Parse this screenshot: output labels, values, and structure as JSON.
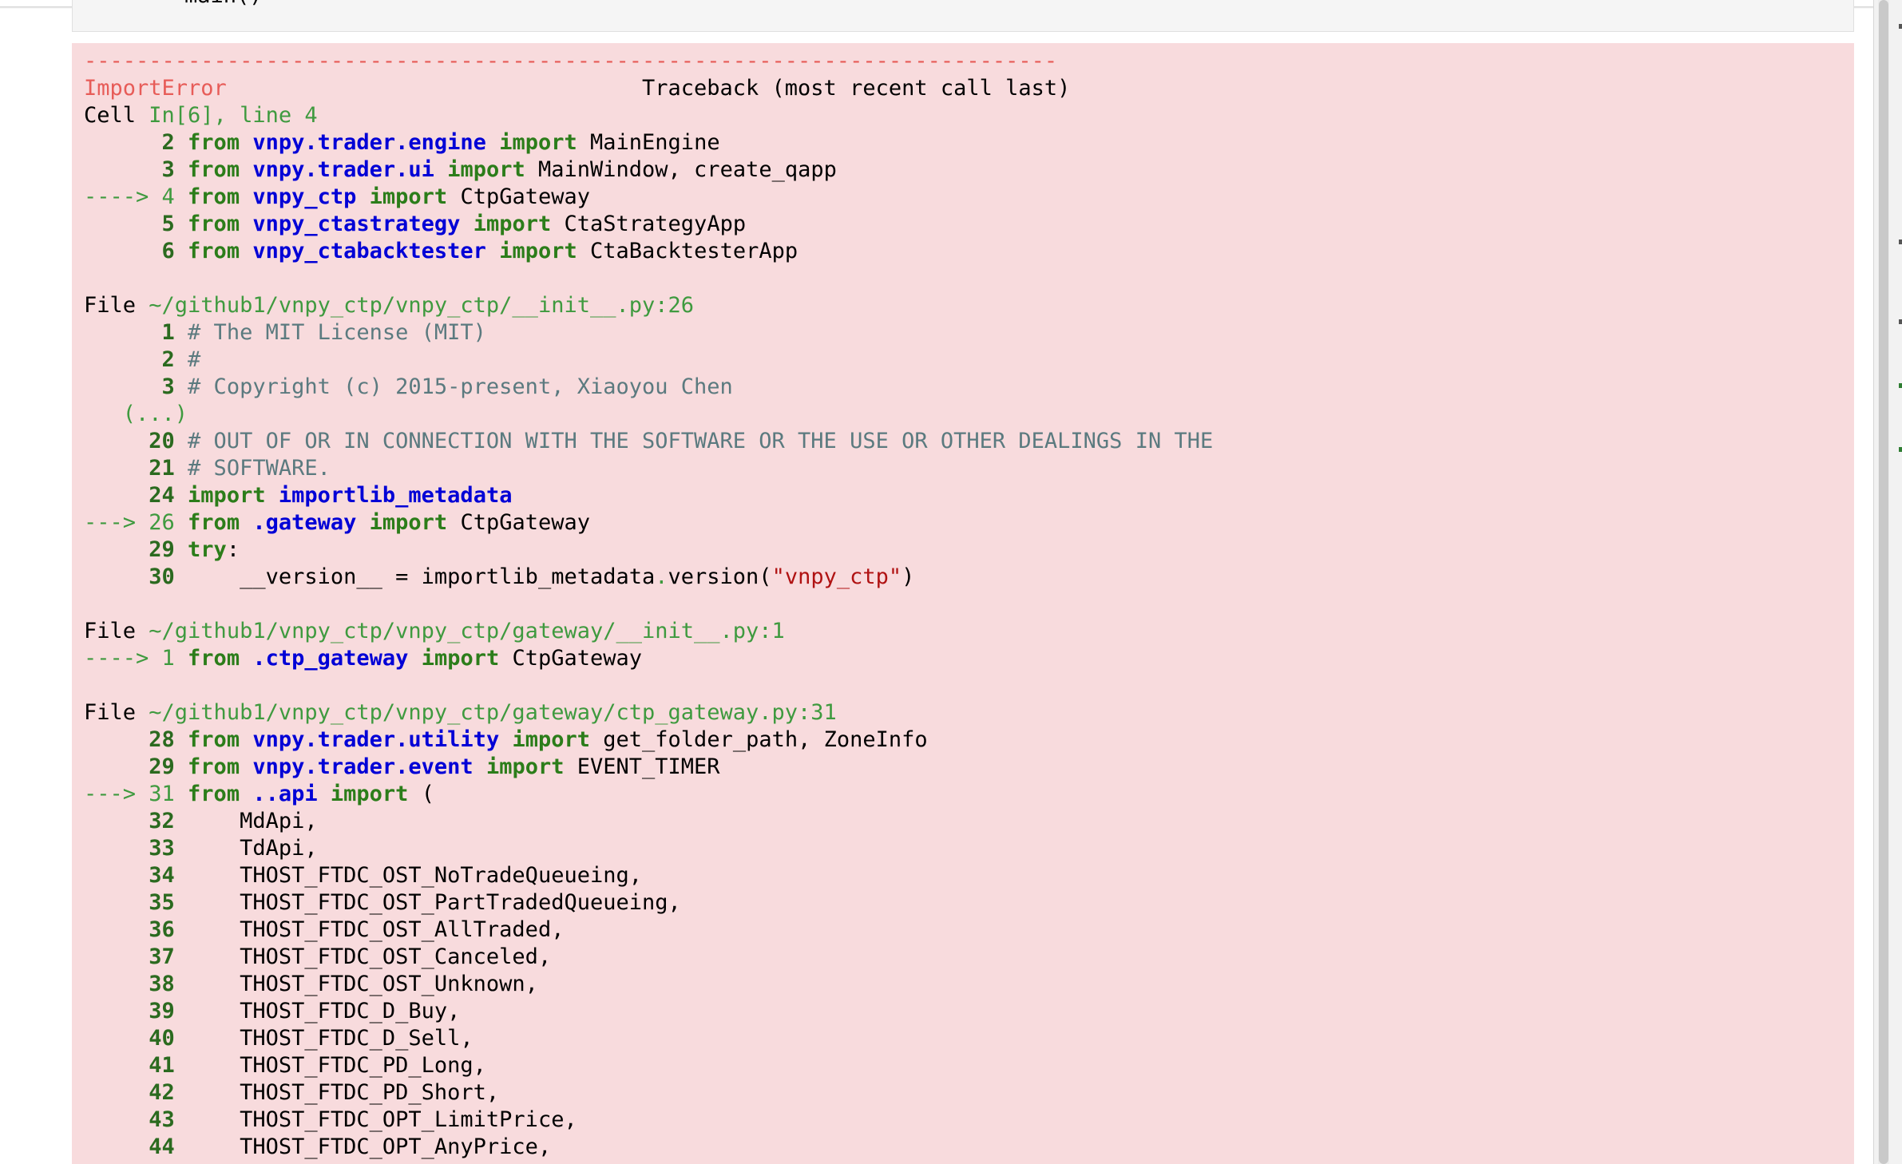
{
  "top_cell": {
    "code": "    main()"
  },
  "traceback": {
    "dash_line": "---------------------------------------------------------------------------",
    "header": {
      "name": "ImportError",
      "gap": "                                ",
      "title": "Traceback (most recent call last)"
    },
    "lines": [
      [
        [
          "",
          "Cell "
        ],
        [
          "green",
          "In[6], line 4"
        ]
      ],
      [
        [
          "lnum",
          "      2 "
        ],
        [
          "kw",
          "from"
        ],
        [
          "",
          " "
        ],
        [
          "mod",
          "vnpy.trader.engine"
        ],
        [
          "",
          " "
        ],
        [
          "kw",
          "import"
        ],
        [
          "",
          " MainEngine"
        ]
      ],
      [
        [
          "lnum",
          "      3 "
        ],
        [
          "kw",
          "from"
        ],
        [
          "",
          " "
        ],
        [
          "mod",
          "vnpy.trader.ui"
        ],
        [
          "",
          " "
        ],
        [
          "kw",
          "import"
        ],
        [
          "",
          " MainWindow, create_qapp"
        ]
      ],
      [
        [
          "arrow",
          "----> 4 "
        ],
        [
          "kw",
          "from"
        ],
        [
          "",
          " "
        ],
        [
          "mod",
          "vnpy_ctp"
        ],
        [
          "",
          " "
        ],
        [
          "kw",
          "import"
        ],
        [
          "",
          " CtpGateway"
        ]
      ],
      [
        [
          "lnum",
          "      5 "
        ],
        [
          "kw",
          "from"
        ],
        [
          "",
          " "
        ],
        [
          "mod",
          "vnpy_ctastrategy"
        ],
        [
          "",
          " "
        ],
        [
          "kw",
          "import"
        ],
        [
          "",
          " CtaStrategyApp"
        ]
      ],
      [
        [
          "lnum",
          "      6 "
        ],
        [
          "kw",
          "from"
        ],
        [
          "",
          " "
        ],
        [
          "mod",
          "vnpy_ctabacktester"
        ],
        [
          "",
          " "
        ],
        [
          "kw",
          "import"
        ],
        [
          "",
          " CtaBacktesterApp"
        ]
      ],
      [
        [
          "",
          " "
        ]
      ],
      [
        [
          "",
          "File "
        ],
        [
          "green",
          "~/github1/vnpy_ctp/vnpy_ctp/__init__.py:26"
        ]
      ],
      [
        [
          "lnum",
          "      1 "
        ],
        [
          "cmt",
          "# The MIT License (MIT)"
        ]
      ],
      [
        [
          "lnum",
          "      2 "
        ],
        [
          "cmt",
          "#"
        ]
      ],
      [
        [
          "lnum",
          "      3 "
        ],
        [
          "cmt",
          "# Copyright (c) 2015-present, Xiaoyou Chen"
        ]
      ],
      [
        [
          "green",
          "   (...)"
        ]
      ],
      [
        [
          "lnum",
          "     20 "
        ],
        [
          "cmt",
          "# OUT OF OR IN CONNECTION WITH THE SOFTWARE OR THE USE OR OTHER DEALINGS IN THE"
        ]
      ],
      [
        [
          "lnum",
          "     21 "
        ],
        [
          "cmt",
          "# SOFTWARE."
        ]
      ],
      [
        [
          "lnum",
          "     24 "
        ],
        [
          "kw",
          "import"
        ],
        [
          "",
          " "
        ],
        [
          "mod",
          "importlib_metadata"
        ]
      ],
      [
        [
          "arrow",
          "---> 26 "
        ],
        [
          "kw",
          "from"
        ],
        [
          "",
          " "
        ],
        [
          "mod",
          ".gateway"
        ],
        [
          "",
          " "
        ],
        [
          "kw",
          "import"
        ],
        [
          "",
          " CtpGateway"
        ]
      ],
      [
        [
          "lnum",
          "     29 "
        ],
        [
          "kw",
          "try"
        ],
        [
          "",
          ":"
        ]
      ],
      [
        [
          "lnum",
          "     30 "
        ],
        [
          "",
          "    __version__ = importlib_metadata"
        ],
        [
          "dot",
          "."
        ],
        [
          "",
          "version("
        ],
        [
          "str",
          "\"vnpy_ctp\""
        ],
        [
          "",
          ")"
        ]
      ],
      [
        [
          "",
          " "
        ]
      ],
      [
        [
          "",
          "File "
        ],
        [
          "green",
          "~/github1/vnpy_ctp/vnpy_ctp/gateway/__init__.py:1"
        ]
      ],
      [
        [
          "arrow",
          "----> 1 "
        ],
        [
          "kw",
          "from"
        ],
        [
          "",
          " "
        ],
        [
          "mod",
          ".ctp_gateway"
        ],
        [
          "",
          " "
        ],
        [
          "kw",
          "import"
        ],
        [
          "",
          " CtpGateway"
        ]
      ],
      [
        [
          "",
          " "
        ]
      ],
      [
        [
          "",
          "File "
        ],
        [
          "green",
          "~/github1/vnpy_ctp/vnpy_ctp/gateway/ctp_gateway.py:31"
        ]
      ],
      [
        [
          "lnum",
          "     28 "
        ],
        [
          "kw",
          "from"
        ],
        [
          "",
          " "
        ],
        [
          "mod",
          "vnpy.trader.utility"
        ],
        [
          "",
          " "
        ],
        [
          "kw",
          "import"
        ],
        [
          "",
          " get_folder_path, ZoneInfo"
        ]
      ],
      [
        [
          "lnum",
          "     29 "
        ],
        [
          "kw",
          "from"
        ],
        [
          "",
          " "
        ],
        [
          "mod",
          "vnpy.trader.event"
        ],
        [
          "",
          " "
        ],
        [
          "kw",
          "import"
        ],
        [
          "",
          " EVENT_TIMER"
        ]
      ],
      [
        [
          "arrow",
          "---> 31 "
        ],
        [
          "kw",
          "from"
        ],
        [
          "",
          " "
        ],
        [
          "mod",
          "..api"
        ],
        [
          "",
          " "
        ],
        [
          "kw",
          "import"
        ],
        [
          "",
          " ("
        ]
      ],
      [
        [
          "lnum",
          "     32 "
        ],
        [
          "",
          "    MdApi,"
        ]
      ],
      [
        [
          "lnum",
          "     33 "
        ],
        [
          "",
          "    TdApi,"
        ]
      ],
      [
        [
          "lnum",
          "     34 "
        ],
        [
          "",
          "    THOST_FTDC_OST_NoTradeQueueing,"
        ]
      ],
      [
        [
          "lnum",
          "     35 "
        ],
        [
          "",
          "    THOST_FTDC_OST_PartTradedQueueing,"
        ]
      ],
      [
        [
          "lnum",
          "     36 "
        ],
        [
          "",
          "    THOST_FTDC_OST_AllTraded,"
        ]
      ],
      [
        [
          "lnum",
          "     37 "
        ],
        [
          "",
          "    THOST_FTDC_OST_Canceled,"
        ]
      ],
      [
        [
          "lnum",
          "     38 "
        ],
        [
          "",
          "    THOST_FTDC_OST_Unknown,"
        ]
      ],
      [
        [
          "lnum",
          "     39 "
        ],
        [
          "",
          "    THOST_FTDC_D_Buy,"
        ]
      ],
      [
        [
          "lnum",
          "     40 "
        ],
        [
          "",
          "    THOST_FTDC_D_Sell,"
        ]
      ],
      [
        [
          "lnum",
          "     41 "
        ],
        [
          "",
          "    THOST_FTDC_PD_Long,"
        ]
      ],
      [
        [
          "lnum",
          "     42 "
        ],
        [
          "",
          "    THOST_FTDC_PD_Short,"
        ]
      ],
      [
        [
          "lnum",
          "     43 "
        ],
        [
          "",
          "    THOST_FTDC_OPT_LimitPrice,"
        ]
      ],
      [
        [
          "lnum",
          "     44 "
        ],
        [
          "",
          "    THOST_FTDC_OPT_AnyPrice,"
        ]
      ]
    ]
  }
}
